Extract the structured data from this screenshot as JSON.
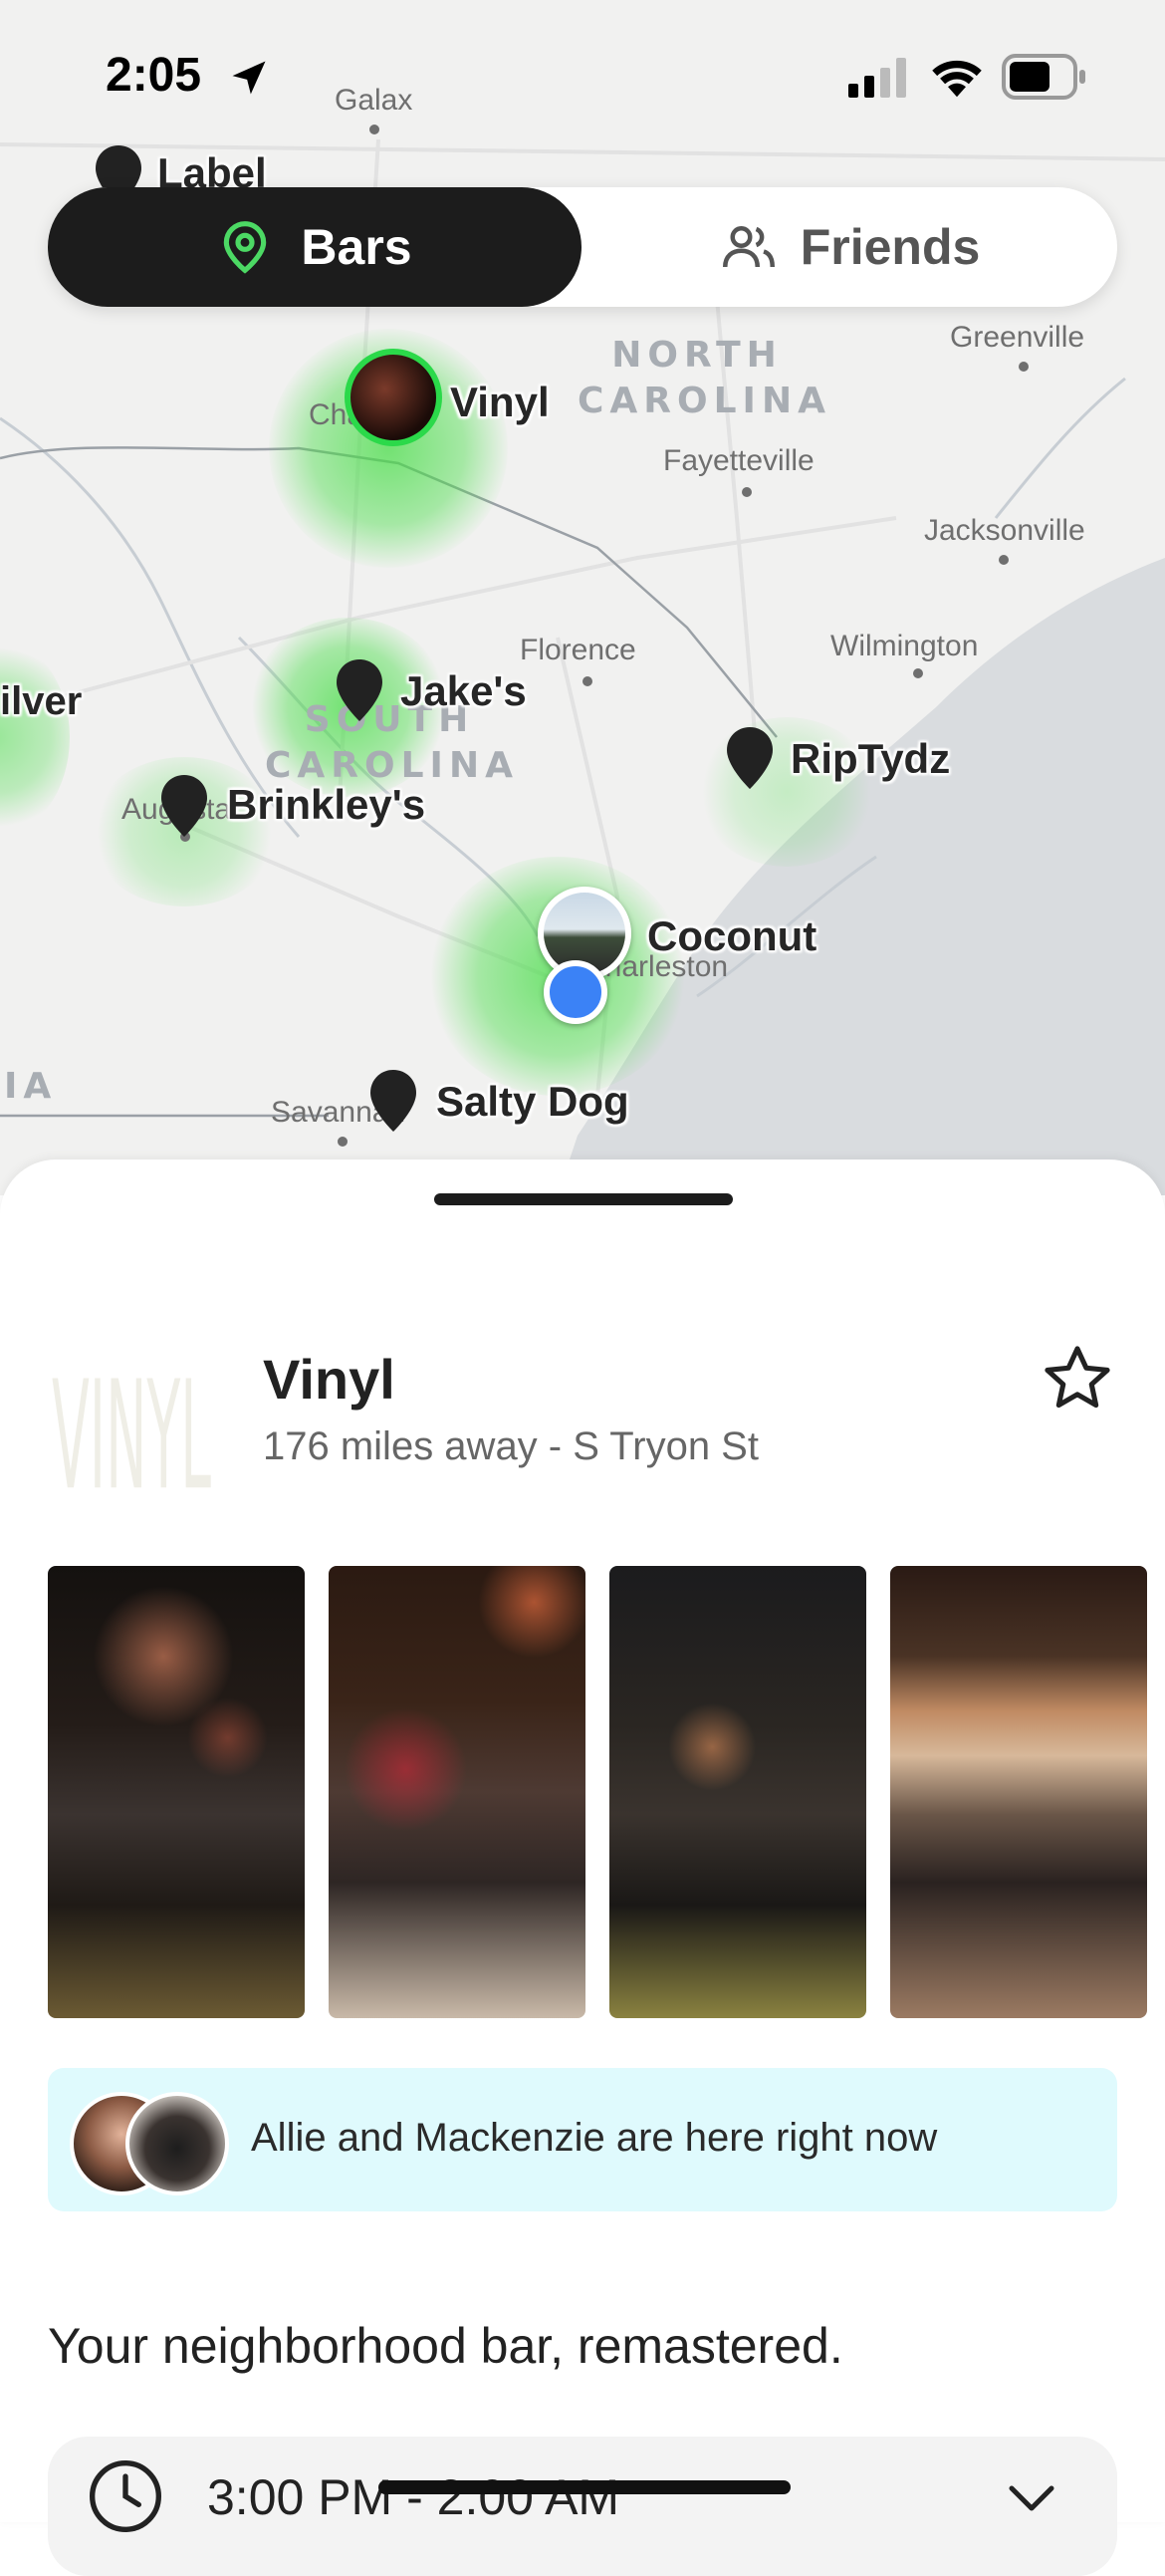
{
  "status_bar": {
    "time": "2:05"
  },
  "segment": {
    "bars_label": "Bars",
    "friends_label": "Friends",
    "active": "Bars"
  },
  "map": {
    "places": [
      "Galax",
      "Greenville",
      "Fayetteville",
      "Jacksonville",
      "Florence",
      "Wilmington",
      "Charleston",
      "Savannah",
      "Augusta",
      "Charlotte"
    ],
    "states": [
      "NORTH CAROLINA",
      "SOUTH CAROLINA",
      "IA"
    ],
    "pins": [
      "Label",
      "Vinyl",
      "Jake's",
      "ilver",
      "Brinkley's",
      "RipTydz",
      "Coconut",
      "Salty Dog"
    ]
  },
  "detail": {
    "logo_text": "VINYL",
    "name": "Vinyl",
    "subtitle": "176 miles away - S Tryon St",
    "friends_here": "Allie and Mackenzie are here right now",
    "tagline": "Your neighborhood bar, remastered.",
    "hours": "3:00 PM - 2:00 AM"
  },
  "colors": {
    "accent_green": "#4cd964",
    "active_segment": "#1c1c1c",
    "friends_box": "#dffafd",
    "user_location": "#3b82f6"
  }
}
